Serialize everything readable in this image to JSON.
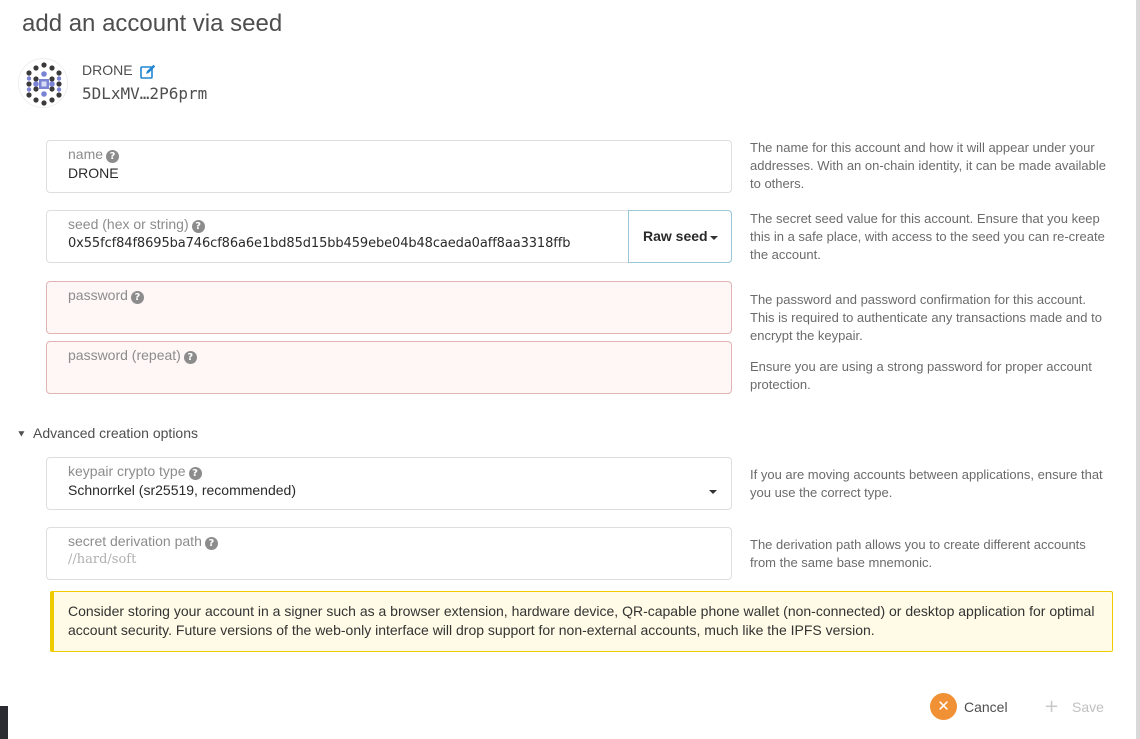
{
  "modal": {
    "title": "add an account via seed"
  },
  "account": {
    "name": "DRONE",
    "address": "5DLxMV…2P6prm"
  },
  "fields": {
    "name": {
      "label": "name",
      "value": "DRONE",
      "help": "The name for this account and how it will appear under your addresses. With an on-chain identity, it can be made available to others."
    },
    "seed": {
      "label": "seed (hex or string)",
      "value": "0x55fcf84f8695ba746cf86a6e1bd85d15bb459ebe04b48caeda0aff8aa3318ffb",
      "type_selected": "Raw seed",
      "help": "The secret seed value for this account. Ensure that you keep this in a safe place, with access to the seed you can re-create the account."
    },
    "password": {
      "label": "password",
      "value": "",
      "help": "The password and password confirmation for this account. This is required to authenticate any transactions made and to encrypt the keypair."
    },
    "password_repeat": {
      "label": "password (repeat)",
      "value": "",
      "help": "Ensure you are using a strong password for proper account protection."
    }
  },
  "advanced": {
    "toggle_label": "Advanced creation options",
    "crypto_type": {
      "label": "keypair crypto type",
      "value": "Schnorrkel (sr25519, recommended)",
      "help": "If you are moving accounts between applications, ensure that you use the correct type."
    },
    "derivation": {
      "label": "secret derivation path",
      "placeholder": "//hard/soft",
      "help": "The derivation path allows you to create different accounts from the same base mnemonic."
    }
  },
  "warning": {
    "text": "Consider storing your account in a signer such as a browser extension, hardware device, QR-capable phone wallet (non-connected) or desktop application for optimal account security. Future versions of the web-only interface will drop support for non-external accounts, much like the IPFS version."
  },
  "actions": {
    "cancel_label": "Cancel",
    "save_label": "Save"
  },
  "colors": {
    "accent": "#f19135",
    "error_bg": "#fff6f6",
    "error_border": "#e0b4b4",
    "warning_bg": "#fffbe6",
    "warning_border": "#efcc00",
    "edit_icon": "#2185d0"
  }
}
